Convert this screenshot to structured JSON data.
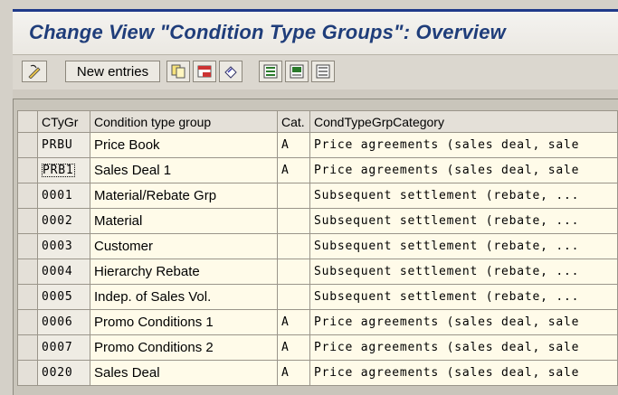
{
  "header": {
    "title": "Change View \"Condition Type Groups\": Overview"
  },
  "toolbar": {
    "new_entries_label": "New entries",
    "icons": [
      "change-display-icon",
      "copy-icon",
      "delete-icon",
      "undo-icon",
      "select-all-icon",
      "select-block-icon",
      "deselect-all-icon"
    ]
  },
  "table": {
    "columns": [
      "CTyGr",
      "Condition type group",
      "Cat.",
      "CondTypeGrpCategory"
    ],
    "rows": [
      [
        "PRBU",
        "Price Book",
        "A",
        "Price agreements (sales deal, sale"
      ],
      [
        "PRB1",
        "Sales Deal 1",
        "A",
        "Price agreements (sales deal, sale"
      ],
      [
        "0001",
        "Material/Rebate Grp",
        "",
        "Subsequent settlement (rebate, ..."
      ],
      [
        "0002",
        "Material",
        "",
        "Subsequent settlement (rebate, ..."
      ],
      [
        "0003",
        "Customer",
        "",
        "Subsequent settlement (rebate, ..."
      ],
      [
        "0004",
        "Hierarchy Rebate",
        "",
        "Subsequent settlement (rebate, ..."
      ],
      [
        "0005",
        "Indep. of Sales Vol.",
        "",
        "Subsequent settlement (rebate, ..."
      ],
      [
        "0006",
        "Promo Conditions 1",
        "A",
        "Price agreements (sales deal, sale"
      ],
      [
        "0007",
        "Promo Conditions 2",
        "A",
        "Price agreements (sales deal, sale"
      ],
      [
        "0020",
        "Sales Deal",
        "A",
        "Price agreements (sales deal, sale"
      ]
    ]
  },
  "colors": {
    "title": "#1f3d7a",
    "row_bg": "#fffbe9",
    "header_bg": "#e4e0d8",
    "frame": "#1f3a8a"
  }
}
